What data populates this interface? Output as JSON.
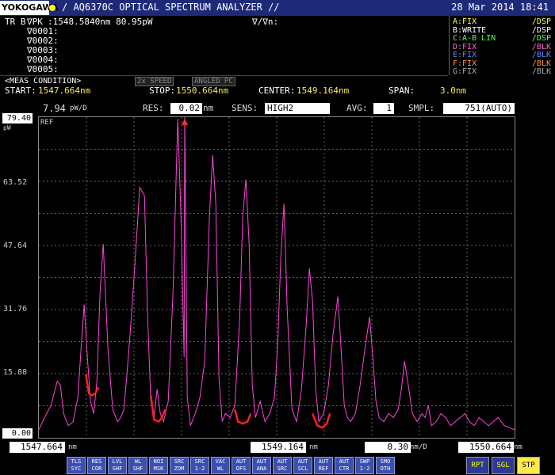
{
  "titlebar": {
    "brand": "YOKOGAWA",
    "title": "/ AQ6370C OPTICAL SPECTRUM ANALYZER //",
    "datetime": "28 Mar 2014 18:41"
  },
  "marker": {
    "header": "TR B",
    "vpk_label": "∇PK",
    "vpk_value": ":1548.5840nm 80.95pW",
    "delta_label": "∇/∇n:",
    "markers": [
      "∇0001:",
      "∇0002:",
      "∇0003:",
      "∇0004:",
      "∇0005:"
    ]
  },
  "traces": [
    {
      "mode": "A:FIX",
      "disp": "/DSP",
      "color": "#ffff55"
    },
    {
      "mode": "B:WRITE",
      "disp": "/DSP",
      "color": "#ffffff",
      "highlight": "#e040c0"
    },
    {
      "mode": "C:A-B LIN",
      "disp": "/DSP",
      "color": "#55ff55"
    },
    {
      "mode": "D:FIX",
      "disp": "/BLK",
      "color": "#ff66cc"
    },
    {
      "mode": "E:FIX",
      "disp": "/BLK",
      "color": "#5588ff"
    },
    {
      "mode": "F:FIX",
      "disp": "/BLK",
      "color": "#ff9933"
    },
    {
      "mode": "G:FIX",
      "disp": "/BLK",
      "color": "#aaaaaa"
    }
  ],
  "meas": {
    "label": "<MEAS CONDITION>",
    "opt1": "2x SPEED",
    "opt2": "ANGLED PC",
    "start_label": "START:",
    "start_value": "1547.664nm",
    "stop_label": "STOP:",
    "stop_value": "1550.664nm",
    "center_label": "CENTER:",
    "center_value": "1549.164nm",
    "span_label": "SPAN:",
    "span_value": "3.0nm"
  },
  "settings": {
    "scale": "7.94",
    "scale_unit": "pW/D",
    "res_label": "RES:",
    "res_value": "0.02",
    "res_unit": "nm",
    "sens_label": "SENS:",
    "sens_value": "HIGH2",
    "avg_label": "AVG:",
    "avg_value": "1",
    "smpl_label": "SMPL:",
    "smpl_value": "751(AUTO)"
  },
  "plot": {
    "ref_value": "79.40",
    "ref_unit": "pW",
    "ref_label": "REF",
    "y_ticks": [
      "63.52",
      "47.64",
      "31.76",
      "15.88",
      "0.00"
    ]
  },
  "bottom": {
    "left_value": "1547.664",
    "left_unit": "nm",
    "center_value": "1549.164",
    "center_unit": "nm",
    "div_value": "0.30",
    "div_unit": "nm/D",
    "right_value": "1550.664",
    "right_unit": "nm"
  },
  "buttons": [
    {
      "l1": "TLS",
      "l2": "SYC"
    },
    {
      "l1": "RES",
      "l2": "COR"
    },
    {
      "l1": "LVL",
      "l2": "SHF"
    },
    {
      "l1": "WL",
      "l2": "SHF"
    },
    {
      "l1": "NOI",
      "l2": "MSK"
    },
    {
      "l1": "SRC",
      "l2": "ZOM"
    },
    {
      "l1": "SRC",
      "l2": "1-2"
    },
    {
      "l1": "VAC",
      "l2": "WL"
    },
    {
      "l1": "AUT",
      "l2": "OFS"
    },
    {
      "l1": "AUT",
      "l2": "ANA"
    },
    {
      "l1": "AUT",
      "l2": "SRC"
    },
    {
      "l1": "AUT",
      "l2": "SCL"
    },
    {
      "l1": "AUT",
      "l2": "REF"
    },
    {
      "l1": "AUT",
      "l2": "CTR"
    },
    {
      "l1": "SWP",
      "l2": "1-2"
    },
    {
      "l1": "SMO",
      "l2": "OTH"
    }
  ],
  "right_buttons": [
    "RPT",
    "SGL",
    "STP"
  ],
  "chart_data": {
    "type": "line",
    "x_unit": "nm",
    "y_unit": "pW",
    "xlim": [
      1547.664,
      1550.664
    ],
    "ylim": [
      0,
      79.4
    ],
    "series": [
      {
        "color": "#ff44dd",
        "x": [
          1547.664,
          1547.7,
          1547.74,
          1547.78,
          1547.8,
          1547.82,
          1547.85,
          1547.88,
          1547.91,
          1547.93,
          1547.95,
          1547.97,
          1547.99,
          1548.01,
          1548.03,
          1548.05,
          1548.07,
          1548.1,
          1548.13,
          1548.16,
          1548.18,
          1548.2,
          1548.22,
          1548.24,
          1548.27,
          1548.3,
          1548.33,
          1548.35,
          1548.37,
          1548.39,
          1548.41,
          1548.43,
          1548.45,
          1548.48,
          1548.51,
          1548.54,
          1548.56,
          1548.58,
          1548.584,
          1548.6,
          1548.62,
          1548.65,
          1548.68,
          1548.71,
          1548.74,
          1548.76,
          1548.78,
          1548.8,
          1548.82,
          1548.84,
          1548.87,
          1548.9,
          1548.93,
          1548.95,
          1548.97,
          1548.99,
          1549.01,
          1549.03,
          1549.06,
          1549.09,
          1549.12,
          1549.15,
          1549.17,
          1549.19,
          1549.21,
          1549.23,
          1549.26,
          1549.29,
          1549.32,
          1549.35,
          1549.37,
          1549.39,
          1549.41,
          1549.43,
          1549.46,
          1549.49,
          1549.52,
          1549.55,
          1549.57,
          1549.59,
          1549.61,
          1549.63,
          1549.66,
          1549.69,
          1549.72,
          1549.75,
          1549.77,
          1549.79,
          1549.81,
          1549.84,
          1549.87,
          1549.9,
          1549.93,
          1549.95,
          1549.97,
          1549.99,
          1550.02,
          1550.05,
          1550.08,
          1550.1,
          1550.12,
          1550.14,
          1550.17,
          1550.2,
          1550.23,
          1550.26,
          1550.29,
          1550.32,
          1550.35,
          1550.38,
          1550.41,
          1550.44,
          1550.47,
          1550.5,
          1550.53,
          1550.56,
          1550.6,
          1550.664
        ],
        "y": [
          2,
          5,
          8,
          14,
          13,
          6,
          3,
          4,
          10,
          22,
          33,
          20,
          9,
          6,
          14,
          36,
          48,
          22,
          7,
          4,
          5,
          7,
          16,
          26,
          43,
          62,
          60,
          30,
          9,
          5,
          12,
          6,
          4,
          9,
          36,
          79,
          55,
          20,
          80.95,
          10,
          3,
          6,
          10,
          19,
          55,
          70,
          58,
          15,
          4,
          6,
          5,
          8,
          29,
          55,
          64,
          48,
          13,
          5,
          9,
          4,
          6,
          10,
          23,
          45,
          58,
          32,
          7,
          4,
          12,
          28,
          42,
          34,
          12,
          4,
          6,
          13,
          26,
          35,
          22,
          8,
          5,
          4,
          6,
          13,
          22,
          30,
          20,
          9,
          5,
          4,
          6,
          5,
          7,
          12,
          19,
          14,
          6,
          4,
          6,
          5,
          8,
          3,
          4,
          6,
          5,
          3,
          4,
          5,
          6,
          4,
          3,
          5,
          4,
          3,
          4,
          5,
          3,
          2
        ]
      },
      {
        "color": "#ff2020",
        "name": "",
        "segments": [
          {
            "x": [
              1547.96,
              1547.98,
              1548.0,
              1548.02,
              1548.04
            ],
            "y": [
              15.8,
              11,
              10.5,
              11,
              12.5
            ]
          },
          {
            "x": [
              1548.37,
              1548.39,
              1548.42,
              1548.44,
              1548.46
            ],
            "y": [
              10.5,
              4.5,
              4,
              5,
              7
            ]
          },
          {
            "x": [
              1548.9,
              1548.92,
              1548.95,
              1548.98,
              1549.0
            ],
            "y": [
              7,
              4,
              3.5,
              4,
              6
            ]
          },
          {
            "x": [
              1549.39,
              1549.42,
              1549.45,
              1549.48,
              1549.5
            ],
            "y": [
              6,
              3,
              2.5,
              3.5,
              6
            ]
          }
        ]
      }
    ]
  }
}
